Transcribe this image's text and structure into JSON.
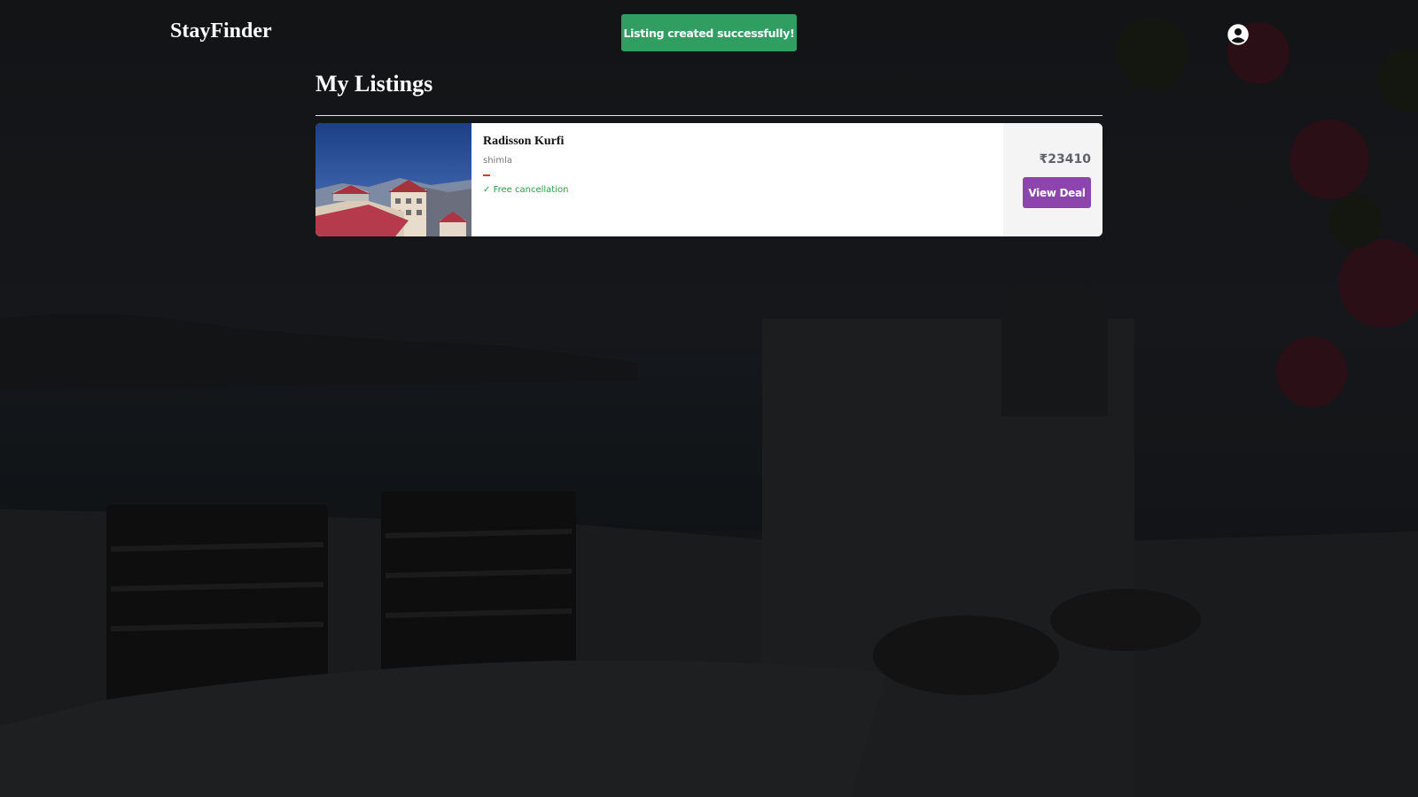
{
  "navbar": {
    "brand": "StayFinder",
    "profile_icon": "user-circle-icon"
  },
  "toast": {
    "message": "Listing created successfully!",
    "color": "#2f9e60"
  },
  "main": {
    "title": "My Listings",
    "listings": [
      {
        "name": "Radisson Kurfi",
        "location": "shimla",
        "free_cancellation": "Free cancellation",
        "check_icon": "✓",
        "price": "₹23410",
        "button_label": "View Deal",
        "button_color": "#8e44ad"
      }
    ]
  }
}
